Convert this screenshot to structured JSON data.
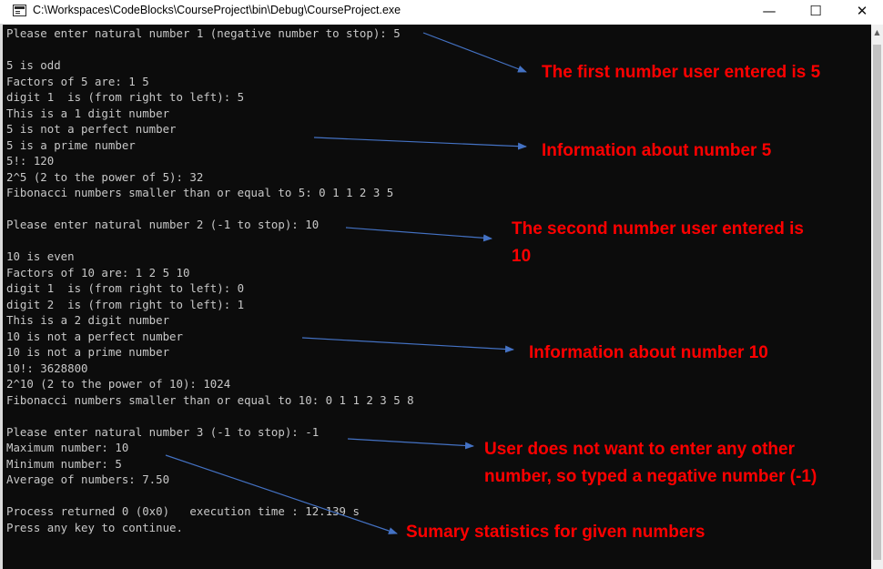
{
  "window": {
    "title": "C:\\Workspaces\\CodeBlocks\\CourseProject\\bin\\Debug\\CourseProject.exe",
    "controls": {
      "minimize": "—",
      "maximize": "☐",
      "close": "✕"
    }
  },
  "console": {
    "text_color": "#c8c8c8",
    "background": "#0c0c0c",
    "lines": [
      "Please enter natural number 1 (negative number to stop): 5",
      "",
      "5 is odd",
      "Factors of 5 are: 1 5",
      "digit 1  is (from right to left): 5",
      "This is a 1 digit number",
      "5 is not a perfect number",
      "5 is a prime number",
      "5!: 120",
      "2^5 (2 to the power of 5): 32",
      "Fibonacci numbers smaller than or equal to 5: 0 1 1 2 3 5",
      "",
      "Please enter natural number 2 (-1 to stop): 10",
      "",
      "10 is even",
      "Factors of 10 are: 1 2 5 10",
      "digit 1  is (from right to left): 0",
      "digit 2  is (from right to left): 1",
      "This is a 2 digit number",
      "10 is not a perfect number",
      "10 is not a prime number",
      "10!: 3628800",
      "2^10 (2 to the power of 10): 1024",
      "Fibonacci numbers smaller than or equal to 10: 0 1 1 2 3 5 8",
      "",
      "Please enter natural number 3 (-1 to stop): -1",
      "Maximum number: 10",
      "Minimum number: 5",
      "Average of numbers: 7.50",
      "",
      "Process returned 0 (0x0)   execution time : 12.139 s",
      "Press any key to continue."
    ]
  },
  "annotations": {
    "color": "#ff0000",
    "arrow_color": "#4472c4",
    "items": [
      {
        "text": "The first number user entered is 5"
      },
      {
        "text": "Information about number 5"
      },
      {
        "text": "The second number user entered is\n10"
      },
      {
        "text": "Information about number 10"
      },
      {
        "text": "User does not want to enter any other\nnumber, so typed a negative number (-1)"
      },
      {
        "text": "Sumary statistics for given numbers"
      }
    ]
  }
}
